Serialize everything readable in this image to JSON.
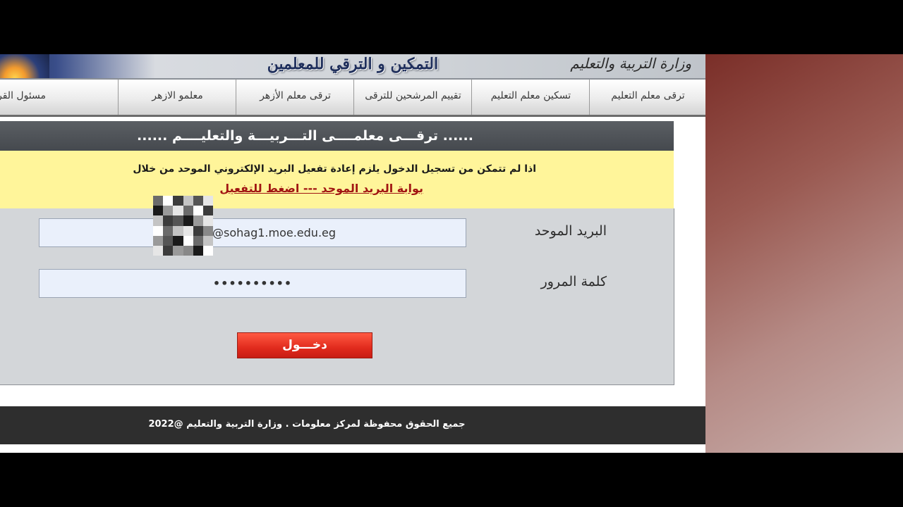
{
  "banner": {
    "title": "التمكين و الترقي للمعلمين",
    "ministry": "وزارة التربية والتعليم"
  },
  "nav": {
    "items": [
      {
        "label": "ترقى معلم التعليم"
      },
      {
        "label": "تسكين معلم التعليم"
      },
      {
        "label": "تقييم المرشحين للترقى"
      },
      {
        "label": "ترقى معلم الأزهر"
      },
      {
        "label": "معلمو الازهر"
      },
      {
        "label": "مسئول القر"
      }
    ]
  },
  "page": {
    "heading": "...... ترقـــى معلمــــى التـــربيـــة والتعليــــم ......"
  },
  "notice": {
    "text": "اذا لم تتمكن من تسجيل الدخول يلزم إعادة تفعيل البريد الإلكتروني الموحد من خلال",
    "link": "بوابة البريد الموحد --- اضغط للتفعيل"
  },
  "form": {
    "email_label": "البريد الموحد",
    "email_value": "@sohag1.moe.edu.eg",
    "password_label": "كلمة المرور",
    "password_value": "••••••••••",
    "submit_label": "دخـــول"
  },
  "footer": {
    "text": "جميع الحقوق محفوظة لمركز معلومات . وزارة التربية والتعليم @2022"
  },
  "colors": {
    "notice_bg": "#fff59a",
    "link": "#a11512",
    "button": "#e12b1d",
    "panel": "#d3d6d9"
  }
}
